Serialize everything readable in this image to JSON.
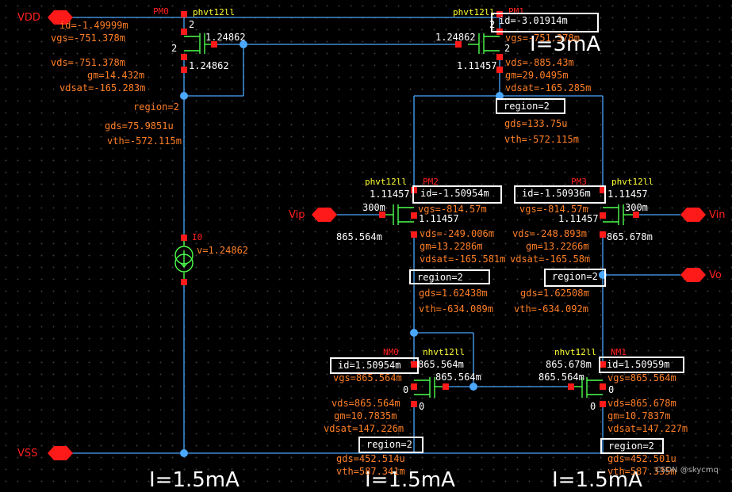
{
  "pins": {
    "vdd": "VDD",
    "vss": "VSS",
    "vip": "Vip",
    "vin": "Vin",
    "vo": "Vo"
  },
  "currents": {
    "top": "I=3mA",
    "bottom_left": "I=1.5mA",
    "bottom_mid": "I=1.5mA",
    "bottom_right": "I=1.5mA"
  },
  "watermark": "CSDN @skycmq",
  "pm0": {
    "name": "PM0",
    "model": "phvt12ll",
    "id": "id=-1.49999m",
    "vgs": "vgs=-751.378m",
    "vds": "vds=-751.378m",
    "gm": "gm=14.432m",
    "vdsat": "vdsat=-165.283m",
    "region": "region=2",
    "gds": "gds=75.9851u",
    "vth": "vth=-572.115m",
    "pin_s": "2",
    "pin_d": "2",
    "node_g": "1.24862",
    "node_b": "1.24862"
  },
  "pm1": {
    "name": "PM1",
    "model": "phvt12ll",
    "id": "id=-3.01914m",
    "vgs": "vgs=-751.378m",
    "vds": "vds=-885.43m",
    "gm": "gm=29.0495m",
    "vdsat": "vdsat=-165.285m",
    "region": "region=2",
    "gds": "gds=133.75u",
    "vth": "vth=-572.115m",
    "pin_s": "2",
    "pin_d": "2",
    "node_g": "1.24862",
    "node_b": "1.11457"
  },
  "pm2": {
    "name": "PM2",
    "model": "phvt12ll",
    "id": "id=-1.50954m",
    "vgs": "vgs=-814.57m",
    "vds": "vds=-249.006m",
    "gm": "gm=13.2286m",
    "vdsat": "vdsat=-165.581m",
    "region": "region=2",
    "gds": "gds=1.62438m",
    "vth": "vth=-634.089m",
    "node_s": "1.11457",
    "node_b": "1.11457",
    "node_g": "300m",
    "node_d": "865.564m"
  },
  "pm3": {
    "name": "PM3",
    "model": "phvt12ll",
    "id": "id=-1.50936m",
    "vgs": "vgs=-814.57m",
    "vds": "vds=-248.893m",
    "gm": "gm=13.2266m",
    "vdsat": "vdsat=-165.58m",
    "region": "region=2",
    "gds": "gds=1.62508m",
    "vth": "vth=-634.092m",
    "node_s": "1.11457",
    "node_b": "1.11457",
    "node_g": "300m",
    "node_d": "865.678m"
  },
  "nm0": {
    "name": "NM0",
    "model": "nhvt12ll",
    "id": "id=1.50954m",
    "vgs": "vgs=865.564m",
    "vds": "vds=865.564m",
    "gm": "gm=10.7835m",
    "vdsat": "vdsat=147.226m",
    "region": "region=2",
    "gds": "gds=452.514u",
    "vth": "vth=587.341m",
    "node_d": "865.564m",
    "node_g": "865.564m",
    "pin_s": "0",
    "pin_b": "0"
  },
  "nm1": {
    "name": "NM1",
    "model": "nhvt12ll",
    "id": "id=1.50959m",
    "vgs": "vgs=865.564m",
    "vds": "vds=865.678m",
    "gm": "gm=10.7837m",
    "vdsat": "vdsat=147.227m",
    "region": "region=2",
    "gds": "gds=452.501u",
    "vth": "vth=587.335m",
    "node_d": "865.678m",
    "node_g": "865.564m",
    "pin_s": "0",
    "pin_b": "0"
  },
  "i0": {
    "name": "I0",
    "v": "v=1.24862"
  }
}
